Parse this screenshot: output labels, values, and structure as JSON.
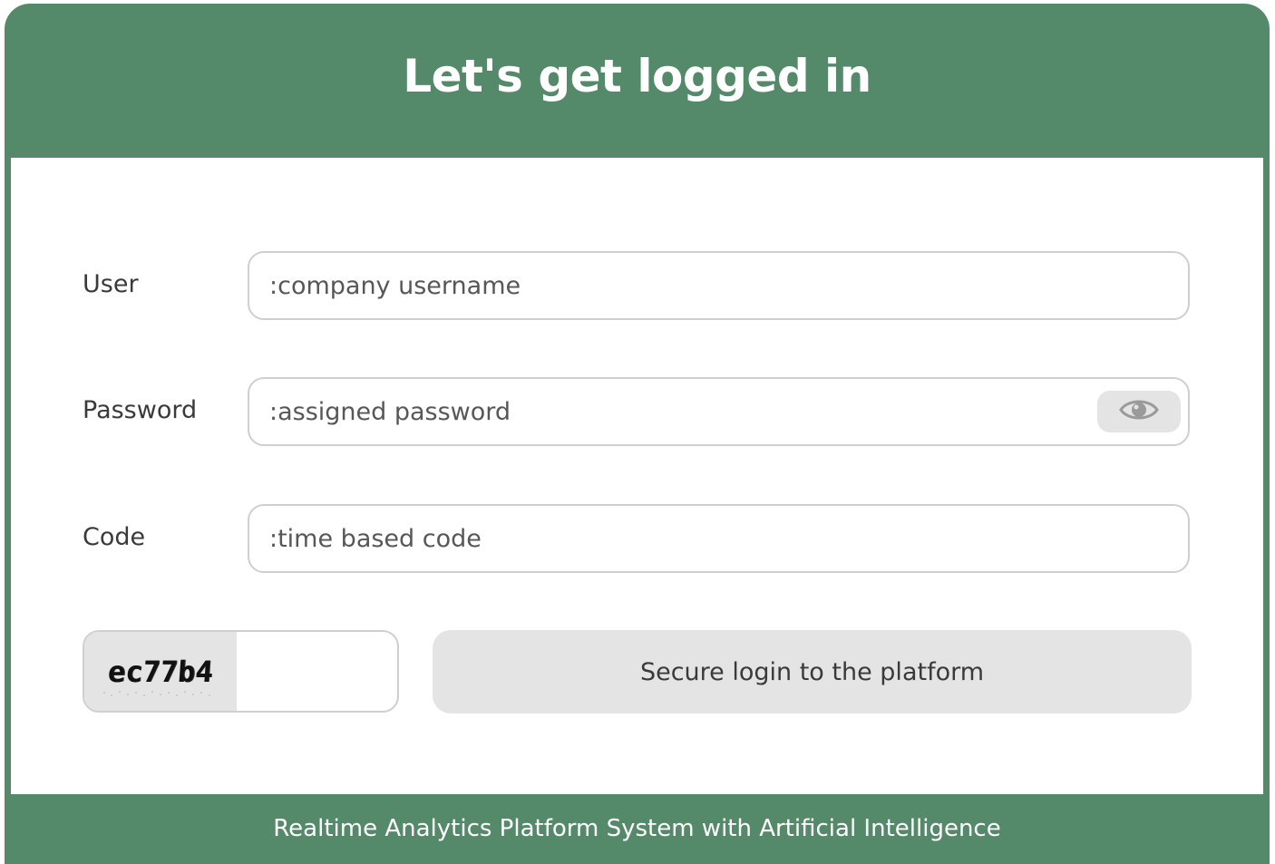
{
  "header": {
    "title": "Let's get logged in"
  },
  "form": {
    "user": {
      "label": "User",
      "placeholder": ":company username",
      "value": ""
    },
    "password": {
      "label": "Password",
      "placeholder": ":assigned password",
      "value": "",
      "toggle_icon": "eye-icon"
    },
    "code": {
      "label": "Code",
      "placeholder": ":time based code",
      "value": ""
    },
    "captcha": {
      "text": "ec77b4",
      "value": ""
    },
    "submit_label": "Secure login to the platform"
  },
  "footer": {
    "text": "Realtime Analytics Platform System with Artificial Intelligence"
  },
  "colors": {
    "brand_green": "#548a69",
    "button_gray": "#e4e4e4",
    "border_gray": "#cfcfcf"
  }
}
